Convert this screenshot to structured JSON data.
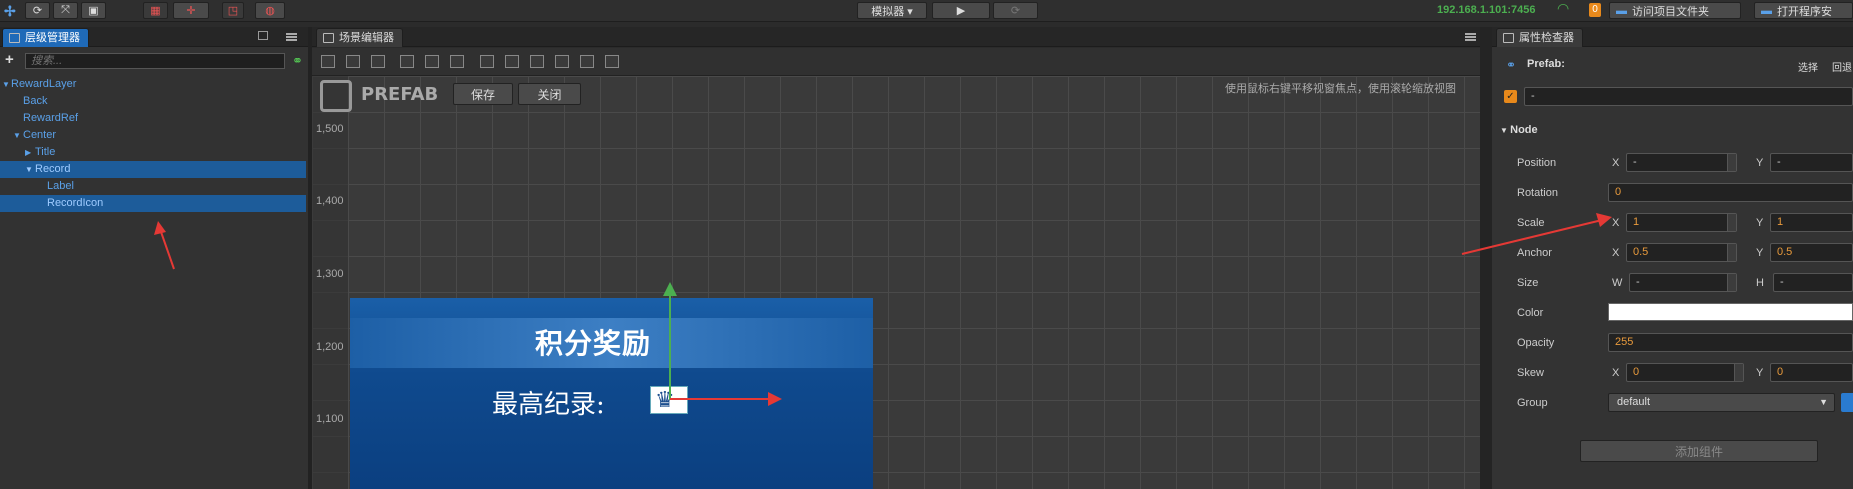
{
  "topbar": {
    "simulator_label": "模拟器 ▾",
    "ip": "192.168.1.101:7456",
    "badge": "0",
    "open_project_folder": "访问项目文件夹",
    "open_app_data": "打开程序安"
  },
  "hierarchy": {
    "tab_label": "层级管理器",
    "search_placeholder": "搜索...",
    "add_label": "+",
    "items": [
      {
        "label": "RewardLayer",
        "arrow": "▼"
      },
      {
        "label": "Back",
        "arrow": ""
      },
      {
        "label": "RewardRef",
        "arrow": ""
      },
      {
        "label": "Center",
        "arrow": "▼"
      },
      {
        "label": "Title",
        "arrow": "▶"
      },
      {
        "label": "Record",
        "arrow": "▼"
      },
      {
        "label": "Label",
        "arrow": ""
      },
      {
        "label": "RecordIcon",
        "arrow": ""
      }
    ]
  },
  "scene": {
    "tab_label": "场景编辑器",
    "prefab_title": "PREFAB",
    "save_label": "保存",
    "close_label": "关闭",
    "hint": "使用鼠标右键平移视窗焦点，使用滚轮缩放视图",
    "y_ticks": [
      "1,500",
      "1,400",
      "1,300",
      "1,200",
      "1,100"
    ],
    "game_title": "积分奖励",
    "record_label": "最高纪录:"
  },
  "inspector": {
    "tab_label": "属性检查器",
    "prefab_label": "Prefab:",
    "select_label": "选择",
    "revert_label": "回退",
    "name_value": "-",
    "node_section": "Node",
    "position": {
      "label": "Position",
      "x": "-",
      "y": "-"
    },
    "rotation": {
      "label": "Rotation",
      "value": "0"
    },
    "scale": {
      "label": "Scale",
      "x": "1",
      "y": "1"
    },
    "anchor": {
      "label": "Anchor",
      "x": "0.5",
      "y": "0.5"
    },
    "size": {
      "label": "Size",
      "w": "-",
      "h": "-"
    },
    "color": {
      "label": "Color",
      "value": "#ffffff"
    },
    "opacity": {
      "label": "Opacity",
      "value": "255"
    },
    "skew": {
      "label": "Skew",
      "x": "0",
      "y": "0"
    },
    "group": {
      "label": "Group",
      "value": "default"
    },
    "add_component": "添加组件",
    "axis_x": "X",
    "axis_y": "Y",
    "axis_w": "W",
    "axis_h": "H"
  },
  "colors": {
    "accent": "#1f6ab8",
    "annotation_arrow": "#e53935"
  }
}
